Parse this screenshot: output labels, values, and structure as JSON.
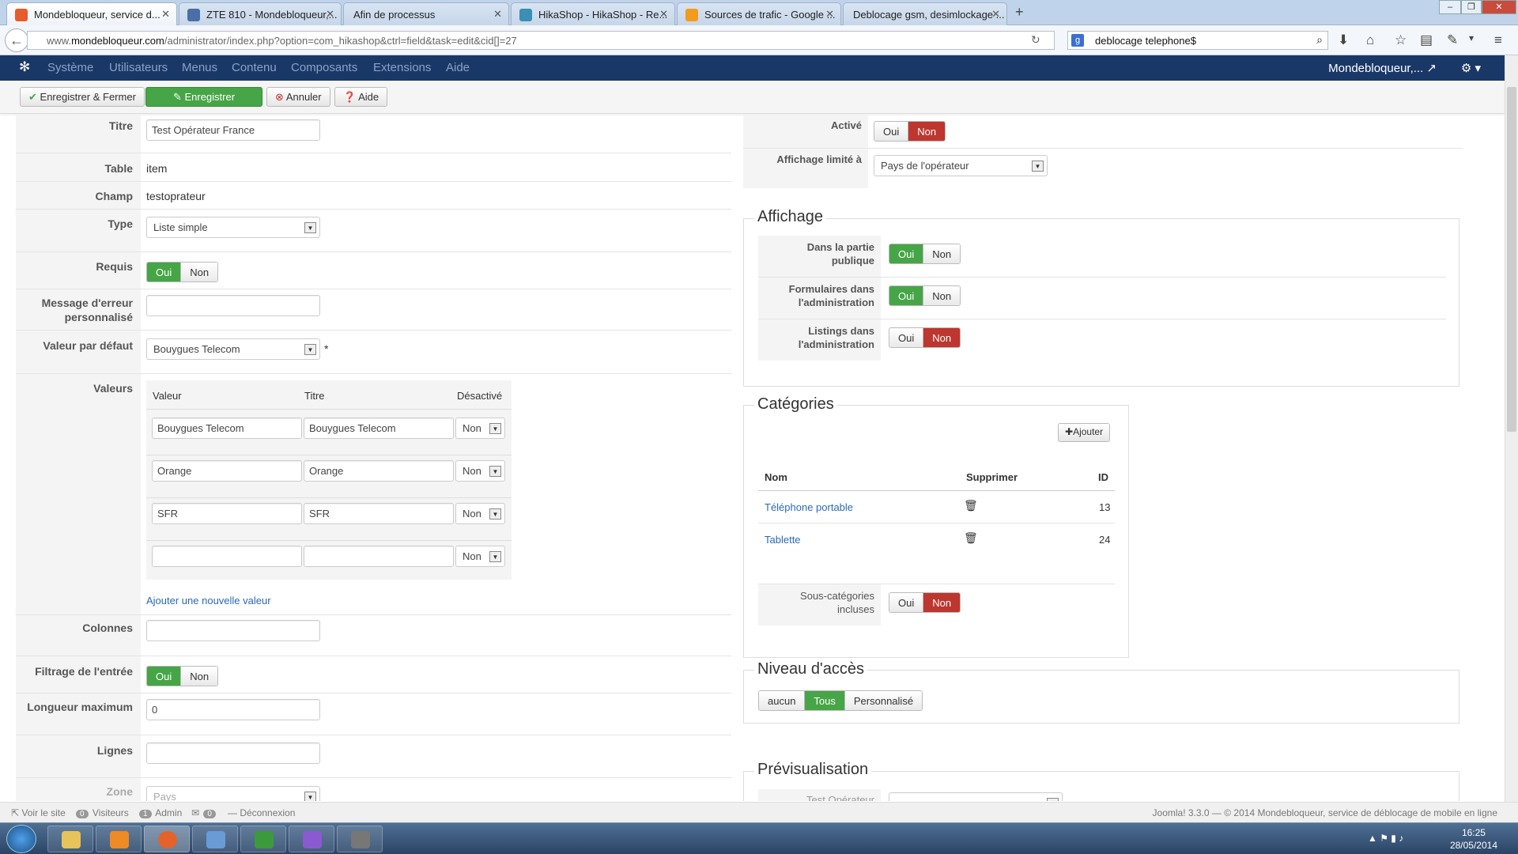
{
  "browser": {
    "tabs": [
      {
        "title": "Mondebloqueur, service d...",
        "active": true
      },
      {
        "title": "ZTE 810 - Mondebloqueur,...",
        "active": false
      },
      {
        "title": "Afin de processus",
        "active": false
      },
      {
        "title": "HikaShop - HikaShop - Re...",
        "active": false
      },
      {
        "title": "Sources de trafic - Google ...",
        "active": false
      },
      {
        "title": "Deblocage gsm, desimlockage ...",
        "active": false
      }
    ],
    "url_prefix": "www.",
    "url_domain": "mondebloqueur.com",
    "url_path": "/administrator/index.php?option=com_hikashop&ctrl=field&task=edit&cid[]=27",
    "search_value": "deblocage telephone$"
  },
  "menu": {
    "items": [
      "Système",
      "Utilisateurs",
      "Menus",
      "Contenu",
      "Composants",
      "Extensions",
      "Aide"
    ],
    "site_user": "Mondebloqueur,..."
  },
  "toolbar": {
    "save_close": "Enregistrer & Fermer",
    "save": "Enregistrer",
    "cancel": "Annuler",
    "help": "Aide"
  },
  "form": {
    "titre_label": "Titre",
    "titre_value": "Test Opérateur France",
    "table_label": "Table",
    "table_value": "item",
    "champ_label": "Champ",
    "champ_value": "testoprateur",
    "type_label": "Type",
    "type_value": "Liste simple",
    "requis_label": "Requis",
    "message_label_1": "Message d'erreur",
    "message_label_2": "personnalisé",
    "defaut_label": "Valeur par défaut",
    "defaut_value": "Bouygues Telecom",
    "defaut_star": "*",
    "valeurs_label": "Valeurs",
    "valeurs_headers": [
      "Valeur",
      "Titre",
      "Désactivé"
    ],
    "valeurs_rows": [
      {
        "valeur": "Bouygues Telecom",
        "titre": "Bouygues Telecom",
        "desactive": "Non"
      },
      {
        "valeur": "Orange",
        "titre": "Orange",
        "desactive": "Non"
      },
      {
        "valeur": "SFR",
        "titre": "SFR",
        "desactive": "Non"
      },
      {
        "valeur": "",
        "titre": "",
        "desactive": "Non"
      }
    ],
    "add_value_link": "Ajouter une nouvelle valeur",
    "colonnes_label": "Colonnes",
    "filtrage_label": "Filtrage de l'entrée",
    "longueur_label": "Longueur maximum",
    "longueur_value": "0",
    "lignes_label": "Lignes",
    "zone_label": "Zone",
    "zone_value": "Pays"
  },
  "toggles": {
    "oui": "Oui",
    "non": "Non"
  },
  "right": {
    "active_label": "Activé",
    "affichage_limite_label": "Affichage limité à",
    "affichage_limite_value": "Pays de l'opérateur",
    "affichage_legend": "Affichage",
    "publique_label_1": "Dans la partie",
    "publique_label_2": "publique",
    "formulaires_label_1": "Formulaires dans",
    "formulaires_label_2": "l'administration",
    "listings_label_1": "Listings dans",
    "listings_label_2": "l'administration",
    "categories_legend": "Catégories",
    "ajouter": "Ajouter",
    "cat_headers": [
      "Nom",
      "Supprimer",
      "ID"
    ],
    "categories": [
      {
        "nom": "Téléphone portable",
        "id": "13"
      },
      {
        "nom": "Tablette",
        "id": "24"
      }
    ],
    "souscat_label_1": "Sous-catégories",
    "souscat_label_2": "incluses",
    "niveau_legend": "Niveau d'accès",
    "niveau_options": [
      "aucun",
      "Tous",
      "Personnalisé"
    ],
    "preview_legend": "Prévisualisation",
    "preview_partial": "Test Opérateur"
  },
  "status": {
    "voir": "Voir le site",
    "visiteurs_count": "0",
    "visiteurs": "Visiteurs",
    "admin_count": "1",
    "admin": "Admin",
    "msg_count": "0",
    "deconnexion": "Déconnexion",
    "copyright": "Joomla! 3.3.0 — © 2014 Mondebloqueur, service de déblocage de mobile en ligne"
  },
  "clock": {
    "time": "16:25",
    "date": "28/05/2014"
  }
}
